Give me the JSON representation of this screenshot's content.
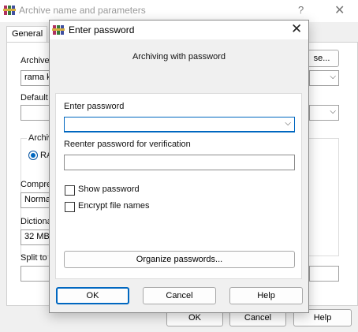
{
  "background": {
    "title": "Archive name and parameters",
    "help_glyph": "?",
    "close_glyph": "✕",
    "tab_general": "General",
    "archive_label": "Archive",
    "archive_value": "rama k",
    "browse_label": "se...",
    "default_label": "Default",
    "archive_group_label": "Archiv",
    "rar_label": "RA",
    "compression_label": "Compre",
    "compression_value": "Normal",
    "dictionary_label": "Dictiona",
    "dictionary_value": "32 MB",
    "split_label": "Split to",
    "ok_label": "OK",
    "cancel_label": "Cancel",
    "help_label": "Help"
  },
  "dialog": {
    "title": "Enter password",
    "close_glyph": "✕",
    "subtitle": "Archiving with password",
    "enter_password_label": "Enter password",
    "enter_password_value": "",
    "reenter_label": "Reenter password for verification",
    "reenter_value": "",
    "show_password_label": "Show password",
    "show_password_checked": false,
    "encrypt_names_label": "Encrypt file names",
    "encrypt_names_checked": false,
    "organize_label": "Organize passwords...",
    "ok_label": "OK",
    "cancel_label": "Cancel",
    "help_label": "Help"
  },
  "icons": {
    "app": "winrar-books-icon",
    "dropdown": "chevron-down-icon"
  },
  "colors": {
    "accent": "#0067c0"
  }
}
